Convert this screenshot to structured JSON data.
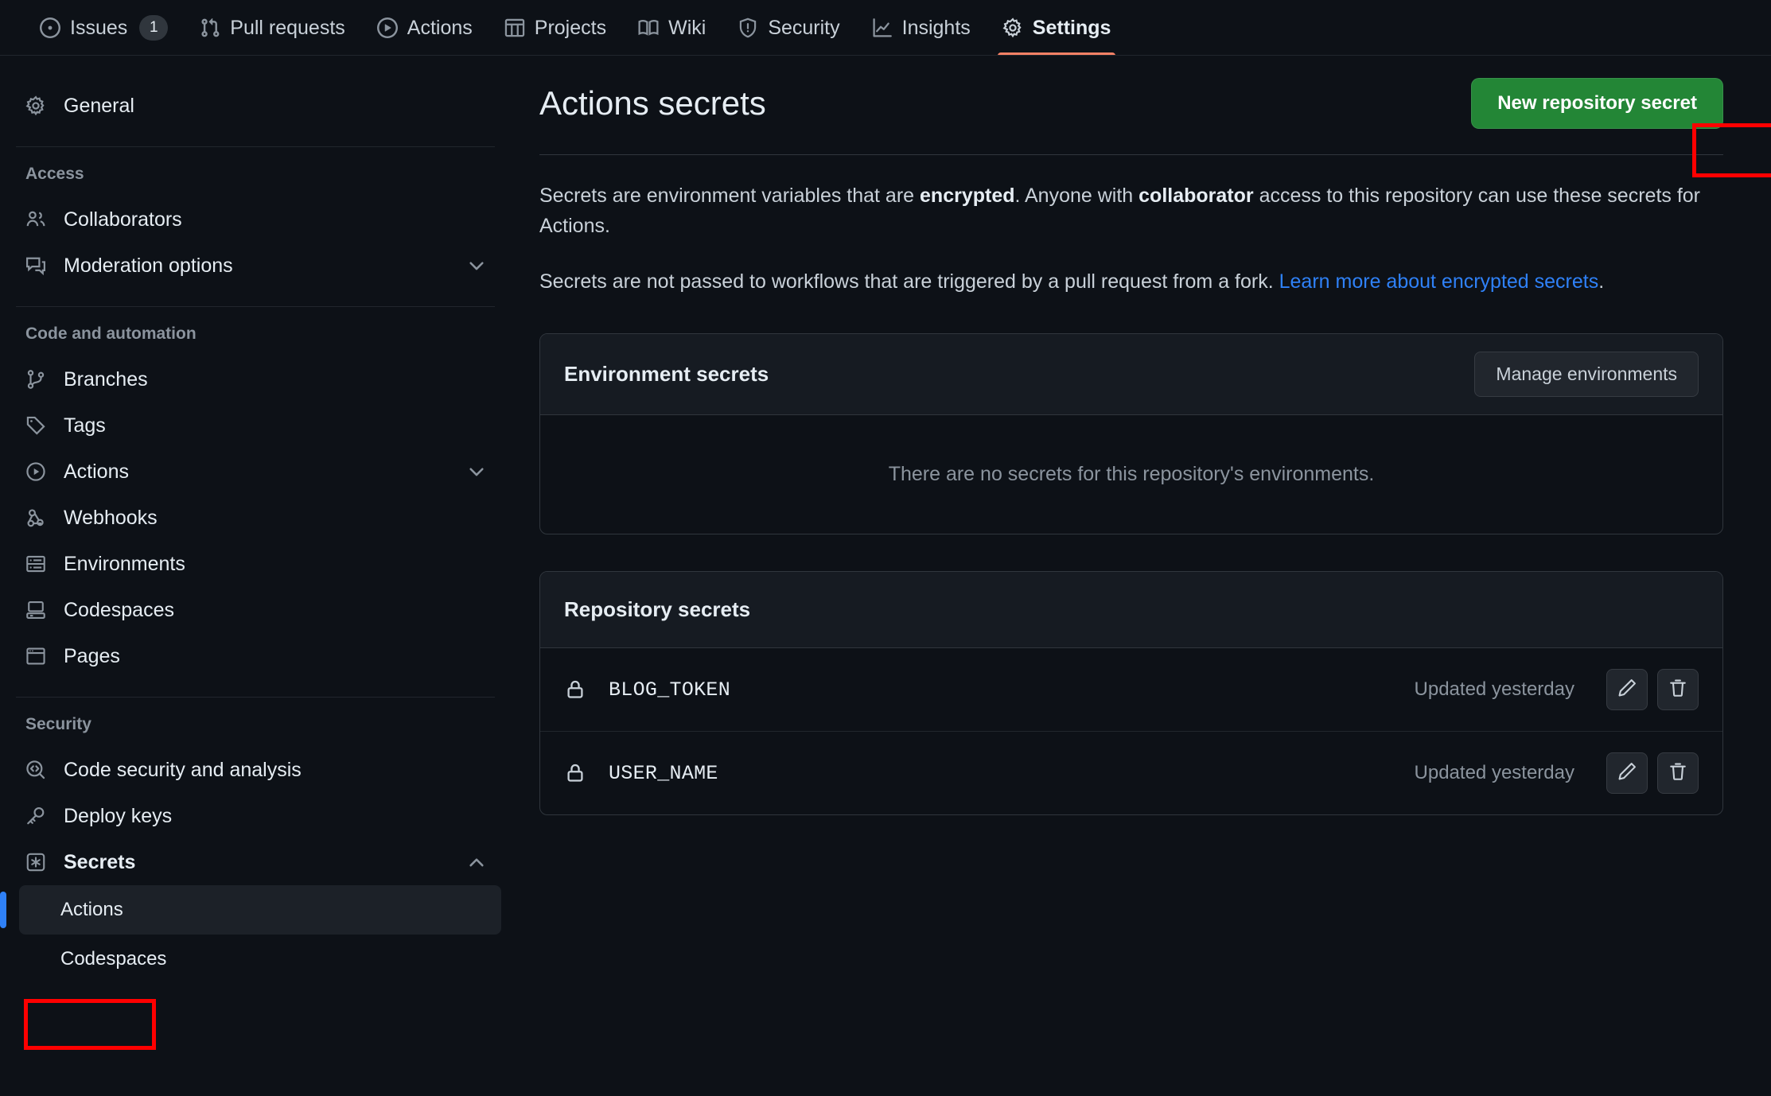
{
  "repo_nav": {
    "tabs": [
      {
        "label": "Issues",
        "icon": "issue-opened-icon",
        "counter": "1",
        "active": false
      },
      {
        "label": "Pull requests",
        "icon": "git-pull-request-icon",
        "counter": null,
        "active": false
      },
      {
        "label": "Actions",
        "icon": "play-icon",
        "counter": null,
        "active": false
      },
      {
        "label": "Projects",
        "icon": "table-icon",
        "counter": null,
        "active": false
      },
      {
        "label": "Wiki",
        "icon": "book-icon",
        "counter": null,
        "active": false
      },
      {
        "label": "Security",
        "icon": "shield-icon",
        "counter": null,
        "active": false
      },
      {
        "label": "Insights",
        "icon": "graph-icon",
        "counter": null,
        "active": false
      },
      {
        "label": "Settings",
        "icon": "gear-icon",
        "counter": null,
        "active": true
      }
    ]
  },
  "sidebar": {
    "general": {
      "label": "General",
      "icon": "gear-icon"
    },
    "groups": [
      {
        "title": "Access",
        "items": [
          {
            "label": "Collaborators",
            "icon": "people-icon",
            "chevron": null
          },
          {
            "label": "Moderation options",
            "icon": "comment-icon",
            "chevron": "down"
          }
        ]
      },
      {
        "title": "Code and automation",
        "items": [
          {
            "label": "Branches",
            "icon": "git-branch-icon",
            "chevron": null
          },
          {
            "label": "Tags",
            "icon": "tag-icon",
            "chevron": null
          },
          {
            "label": "Actions",
            "icon": "play-icon",
            "chevron": "down"
          },
          {
            "label": "Webhooks",
            "icon": "webhook-icon",
            "chevron": null
          },
          {
            "label": "Environments",
            "icon": "server-icon",
            "chevron": null
          },
          {
            "label": "Codespaces",
            "icon": "codespaces-icon",
            "chevron": null
          },
          {
            "label": "Pages",
            "icon": "browser-icon",
            "chevron": null
          }
        ]
      },
      {
        "title": "Security",
        "items": [
          {
            "label": "Code security and analysis",
            "icon": "codescan-icon",
            "chevron": null
          },
          {
            "label": "Deploy keys",
            "icon": "key-icon",
            "chevron": null
          },
          {
            "label": "Secrets",
            "icon": "asterisk-key-icon",
            "chevron": "up",
            "bold": true
          }
        ]
      }
    ],
    "secrets_sub_items": [
      {
        "label": "Actions",
        "selected": true
      },
      {
        "label": "Codespaces",
        "selected": false
      }
    ]
  },
  "main": {
    "title": "Actions secrets",
    "new_secret_button": "New repository secret",
    "paragraph1": {
      "part1": "Secrets are environment variables that are ",
      "bold1": "encrypted",
      "part2": ". Anyone with ",
      "bold2": "collaborator",
      "part3": " access to this repository can use these secrets for Actions."
    },
    "paragraph2": {
      "text": "Secrets are not passed to workflows that are triggered by a pull request from a fork. ",
      "link": "Learn more about encrypted secrets",
      "suffix": "."
    },
    "environment_secrets": {
      "title": "Environment secrets",
      "manage_button": "Manage environments",
      "empty_message": "There are no secrets for this repository's environments."
    },
    "repository_secrets": {
      "title": "Repository secrets",
      "rows": [
        {
          "name": "BLOG_TOKEN",
          "updated": "Updated yesterday",
          "lock_icon": "lock-icon",
          "edit_icon": "pencil-icon",
          "delete_icon": "trash-icon"
        },
        {
          "name": "USER_NAME",
          "updated": "Updated yesterday",
          "lock_icon": "lock-icon",
          "edit_icon": "pencil-icon",
          "delete_icon": "trash-icon"
        }
      ]
    }
  },
  "colors": {
    "page_background": "#0d1117",
    "card_header_background": "#161b22",
    "border": "#30363d",
    "primary_button": "#238636",
    "link": "#2f81f7",
    "active_tab_underline": "#f78166",
    "active_sidebar_bar": "#2f81f7",
    "annotation_highlight": "#ff0000"
  },
  "annotations": [
    {
      "name": "new-repository-secret-highlight"
    },
    {
      "name": "sidebar-actions-highlight"
    }
  ]
}
